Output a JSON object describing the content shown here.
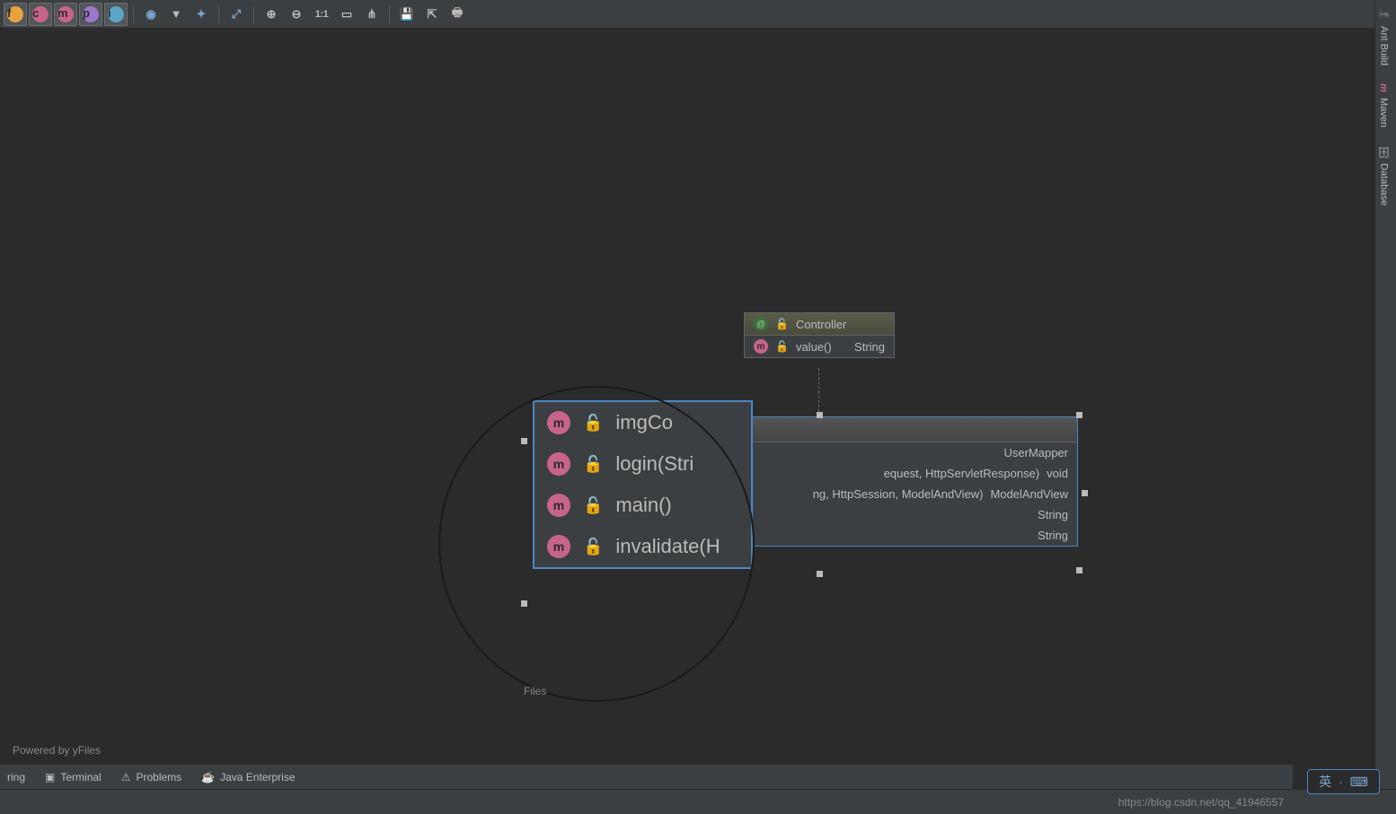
{
  "toolbar": {
    "label_11": "1:1"
  },
  "right_sidebar": {
    "ant_build": "Ant Build",
    "maven": "Maven",
    "database": "Database"
  },
  "controller_box": {
    "header": "Controller",
    "rows": [
      {
        "name": "value()",
        "type": "String"
      }
    ]
  },
  "main_box": {
    "rows": [
      {
        "name": "",
        "type": "UserMapper"
      },
      {
        "name": "equest, HttpServletResponse)",
        "type": "void"
      },
      {
        "name": "ng, HttpSession, ModelAndView)",
        "type": "ModelAndView"
      },
      {
        "name": "",
        "type": "String"
      },
      {
        "name": "",
        "type": "String"
      }
    ]
  },
  "magnified": {
    "rows": [
      "imgCo",
      "login(Stri",
      "main()",
      "invalidate(H"
    ]
  },
  "bottom_tabs": {
    "ring": "ring",
    "terminal": "Terminal",
    "problems": "Problems",
    "java_ee": "Java Enterprise"
  },
  "powered": "Powered by yFiles",
  "yfiles_small": "Files",
  "watermark": "https://blog.csdn.net/qq_41946557",
  "ime": {
    "lang": "英",
    "sep": "·"
  }
}
